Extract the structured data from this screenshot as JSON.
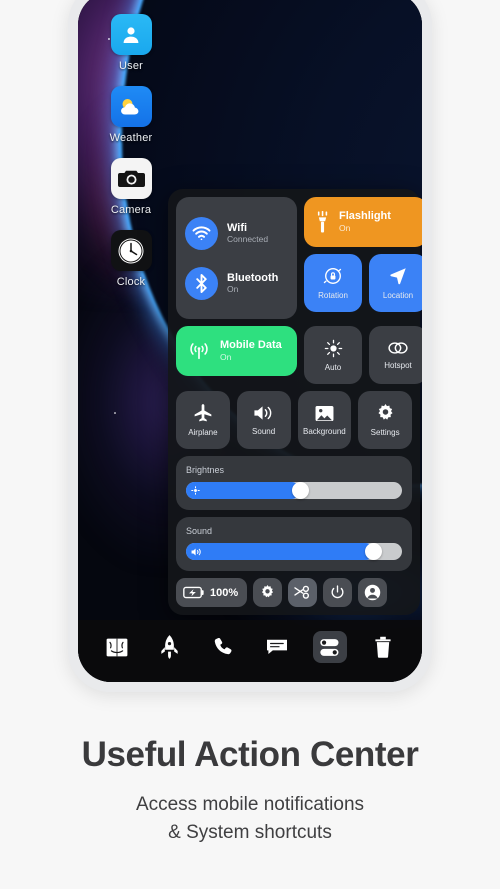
{
  "wallpaper": {
    "name": "space-nebula-planet"
  },
  "home_apps": [
    {
      "label": "User",
      "icon": "user-icon"
    },
    {
      "label": "Weather",
      "icon": "weather-icon"
    },
    {
      "label": "Camera",
      "icon": "camera-icon"
    },
    {
      "label": "Clock",
      "icon": "clock-icon"
    }
  ],
  "control_center": {
    "connectivity": [
      {
        "title": "Wifi",
        "status": "Connected",
        "icon": "wifi-icon",
        "color": "#3b82f6"
      },
      {
        "title": "Bluetooth",
        "status": "On",
        "icon": "bluetooth-icon",
        "color": "#3b82f6"
      }
    ],
    "wide_tiles": [
      {
        "title": "Flashlight",
        "status": "On",
        "icon": "flashlight-icon",
        "color": "#ef9621"
      },
      {
        "title": "Mobile Data",
        "status": "On",
        "icon": "cell-signal-icon",
        "color": "#2ee07f"
      }
    ],
    "toggle_tiles": [
      {
        "label": "Rotation",
        "icon": "rotation-lock-icon",
        "state": "on",
        "color": "#3b82f6"
      },
      {
        "label": "Location",
        "icon": "location-arrow-icon",
        "state": "on",
        "color": "#3b82f6"
      },
      {
        "label": "Auto",
        "icon": "brightness-auto-icon",
        "state": "off",
        "color": "#3b3e44"
      },
      {
        "label": "Hotspot",
        "icon": "hotspot-icon",
        "state": "off",
        "color": "#3b3e44"
      }
    ],
    "grid_tiles": [
      {
        "label": "Airplane",
        "icon": "airplane-icon",
        "state": "off",
        "color": "#3b3e44"
      },
      {
        "label": "Sound",
        "icon": "speaker-icon",
        "state": "off",
        "color": "#3b3e44"
      },
      {
        "label": "Background",
        "icon": "image-icon",
        "state": "off",
        "color": "#3b3e44"
      },
      {
        "label": "Settings",
        "icon": "gear-icon",
        "state": "off",
        "color": "#3b3e44"
      }
    ],
    "sliders": [
      {
        "label": "Brightnes",
        "value": 53,
        "icon": "brightness-icon",
        "fill_color": "#2f7cf6"
      },
      {
        "label": "Sound",
        "value": 87,
        "icon": "volume-icon",
        "fill_color": "#2f7cf6"
      }
    ],
    "actions": {
      "battery_label": "100%",
      "battery_icon": "battery-charging-icon",
      "buttons": [
        {
          "icon": "gear-icon",
          "name": "settings-button",
          "state": "off"
        },
        {
          "icon": "screenshot-icon",
          "name": "screenshot-button",
          "state": "on"
        },
        {
          "icon": "power-icon",
          "name": "power-button",
          "state": "off"
        },
        {
          "icon": "account-icon",
          "name": "account-button",
          "state": "off"
        }
      ]
    }
  },
  "dock": [
    {
      "icon": "finder-icon",
      "name": "dock-finder",
      "active": false
    },
    {
      "icon": "rocket-icon",
      "name": "dock-launcher",
      "active": false
    },
    {
      "icon": "phone-icon",
      "name": "dock-phone",
      "active": false
    },
    {
      "icon": "message-icon",
      "name": "dock-messages",
      "active": false
    },
    {
      "icon": "toggles-icon",
      "name": "dock-control-center",
      "active": true
    },
    {
      "icon": "trash-icon",
      "name": "dock-trash",
      "active": false
    }
  ],
  "caption": {
    "title": "Useful Action Center",
    "subtitle_line1": "Access mobile notifications",
    "subtitle_line2": "& System shortcuts"
  }
}
